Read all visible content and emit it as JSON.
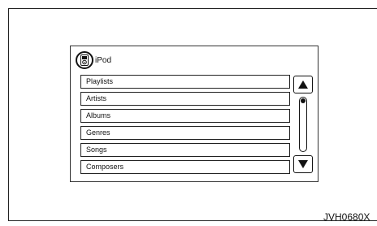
{
  "header": {
    "title": "iPod",
    "icon": "ipod-icon"
  },
  "menu": {
    "items": [
      {
        "label": "Playlists"
      },
      {
        "label": "Artists"
      },
      {
        "label": "Albums"
      },
      {
        "label": "Genres"
      },
      {
        "label": "Songs"
      },
      {
        "label": "Composers"
      }
    ]
  },
  "scrollbar": {
    "up_icon": "triangle-up-icon",
    "down_icon": "triangle-down-icon",
    "position": 0
  },
  "figure": {
    "code": "JVH0680X"
  }
}
